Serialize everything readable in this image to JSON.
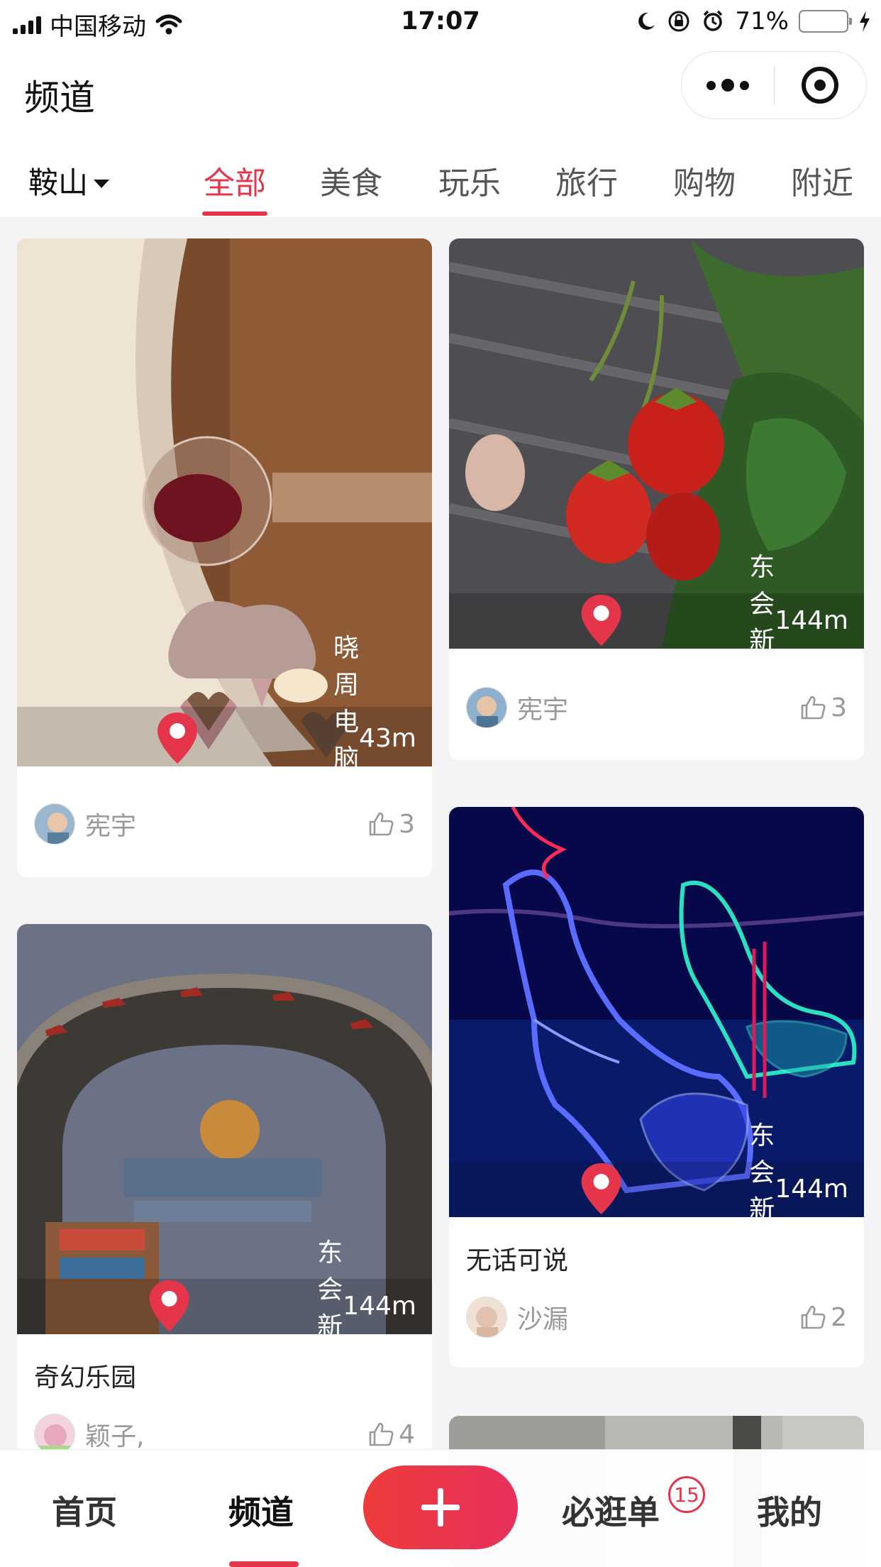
{
  "status_bar": {
    "carrier": "中国移动",
    "time": "17:07",
    "battery_percent": "71%",
    "battery_level": 0.71,
    "icons": [
      "signal-icon",
      "wifi-icon",
      "moon-icon",
      "orientation-lock-icon",
      "alarm-icon",
      "battery-icon",
      "charging-icon"
    ]
  },
  "header": {
    "title": "频道",
    "capsule_icons": [
      "more-dots-icon",
      "target-icon"
    ]
  },
  "tabs": {
    "city": "鞍山",
    "items": [
      "全部",
      "美食",
      "玩乐",
      "旅行",
      "购物",
      "附近"
    ],
    "active_index": 0
  },
  "feed": [
    {
      "location": "晓周电脑维修",
      "distance": "43m",
      "title": "",
      "user": "宪宇",
      "likes": "3",
      "image": "room-with-hanging-glass-ball"
    },
    {
      "location": "东会新村",
      "distance": "144m",
      "title": "",
      "user": "宪宇",
      "likes": "3",
      "image": "strawberries-on-wood"
    },
    {
      "location": "东会新村",
      "distance": "144m",
      "title": "奇幻乐园",
      "user": "颖子,",
      "likes": "4",
      "image": "amusement-park-arch"
    },
    {
      "location": "东会新村",
      "distance": "144m",
      "title": "无话可说",
      "user": "沙漏",
      "likes": "2",
      "image": "light-sculpture-high-heels"
    }
  ],
  "bottom_nav": {
    "items": [
      "首页",
      "频道",
      "必逛单",
      "我的"
    ],
    "active": "频道",
    "badge_count": "15",
    "colors": {
      "accent": "#e5354a"
    }
  }
}
